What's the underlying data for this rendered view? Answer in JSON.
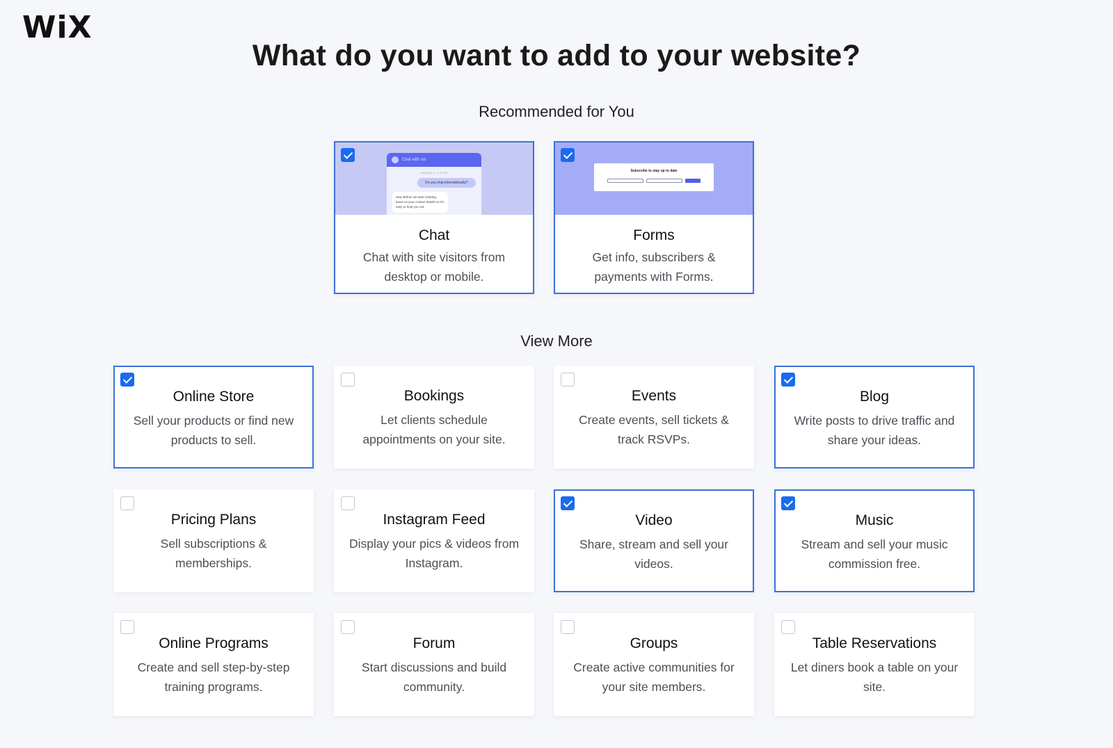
{
  "logo": "WiX",
  "title": "What do you want to add to your website?",
  "sections": {
    "recommended": "Recommended for You",
    "more": "View More"
  },
  "colors": {
    "accent": "#3a73d8",
    "checkbox_checked": "#1a6bf0",
    "chat_preview_bg": "#c6c9f3",
    "forms_preview_bg": "#a4acf7"
  },
  "recommended": [
    {
      "name": "Chat",
      "desc": "Chat with site visitors from desktop or mobile.",
      "checked": true,
      "preview": {
        "header": "Chat with us!",
        "timestamp": "Wed Sep 1 · 4:36 PM",
        "user_message": "Do you ship internationally?",
        "reply": "Hey! Before we start chatting, leave us your contact details so it's easy to help you out."
      }
    },
    {
      "name": "Forms",
      "desc": "Get info, subscribers & payments with Forms.",
      "checked": true,
      "preview": {
        "form_title": "Subscribe to stay up to date"
      }
    }
  ],
  "more": [
    {
      "name": "Online Store",
      "desc": "Sell your products or find new products to sell.",
      "checked": true
    },
    {
      "name": "Bookings",
      "desc": "Let clients schedule appointments on your site.",
      "checked": false
    },
    {
      "name": "Events",
      "desc": "Create events, sell tickets & track RSVPs.",
      "checked": false
    },
    {
      "name": "Blog",
      "desc": "Write posts to drive traffic and share your ideas.",
      "checked": true
    },
    {
      "name": "Pricing Plans",
      "desc": "Sell subscriptions & memberships.",
      "checked": false
    },
    {
      "name": "Instagram Feed",
      "desc": "Display your pics & videos from Instagram.",
      "checked": false
    },
    {
      "name": "Video",
      "desc": "Share, stream and sell your videos.",
      "checked": true
    },
    {
      "name": "Music",
      "desc": "Stream and sell your music commission free.",
      "checked": true
    },
    {
      "name": "Online Programs",
      "desc": "Create and sell step-by-step training programs.",
      "checked": false
    },
    {
      "name": "Forum",
      "desc": "Start discussions and build community.",
      "checked": false
    },
    {
      "name": "Groups",
      "desc": "Create active communities for your site members.",
      "checked": false
    },
    {
      "name": "Table Reservations",
      "desc": "Let diners book a table on your site.",
      "checked": false
    }
  ]
}
